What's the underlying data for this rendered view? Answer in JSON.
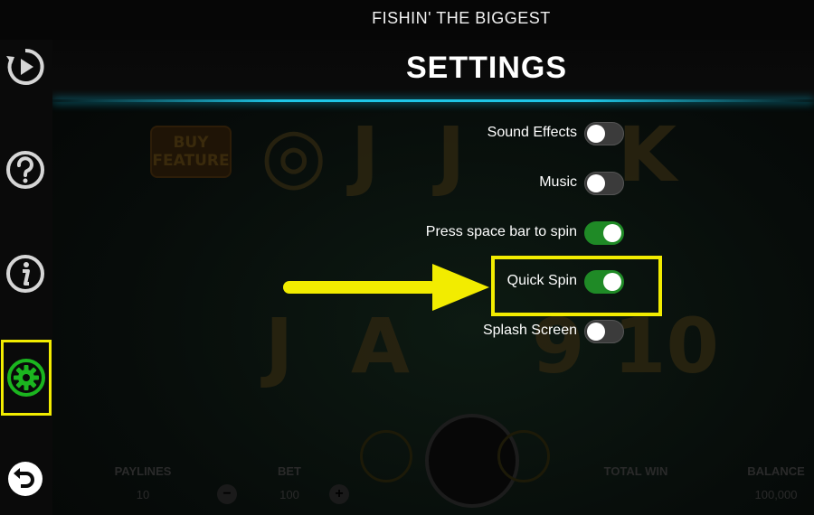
{
  "window": {
    "title": "FISHIN' THE BIGGEST"
  },
  "settings": {
    "title": "SETTINGS",
    "options": [
      {
        "label": "Sound Effects",
        "enabled": false
      },
      {
        "label": "Music",
        "enabled": false
      },
      {
        "label": "Press space bar to spin",
        "enabled": true
      },
      {
        "label": "Quick Spin",
        "enabled": true,
        "highlighted": true
      },
      {
        "label": "Splash Screen",
        "enabled": false
      }
    ]
  },
  "sidebar": {
    "items": [
      {
        "name": "autoplay",
        "icon": "replay-play-icon"
      },
      {
        "name": "help",
        "icon": "question-icon"
      },
      {
        "name": "info",
        "icon": "info-icon"
      },
      {
        "name": "settings",
        "icon": "gear-icon",
        "active": true
      },
      {
        "name": "back",
        "icon": "back-arrow-icon"
      }
    ]
  },
  "game_background": {
    "buy_feature": "BUY FEATURE",
    "paylines": {
      "label": "PAYLINES",
      "value": "10"
    },
    "bet": {
      "label": "BET",
      "value": "100"
    },
    "total_win": {
      "label": "TOTAL WIN"
    },
    "balance": {
      "label": "BALANCE",
      "value": "100,000"
    }
  },
  "colors": {
    "highlight": "#f2ec00",
    "toggle_on": "#1f8a26",
    "toggle_off": "#3b3b3b",
    "header_glow": "#1fc6e6"
  }
}
